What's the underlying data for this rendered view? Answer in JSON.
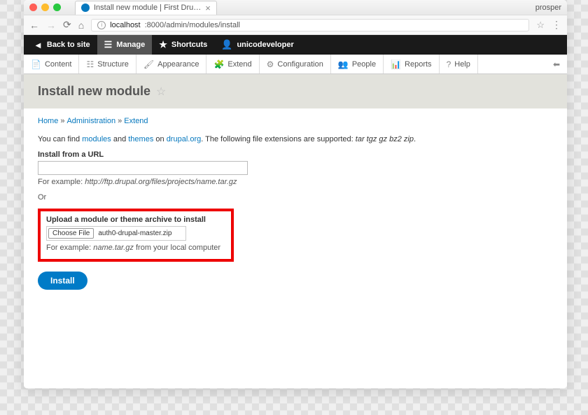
{
  "browser": {
    "tab_title": "Install new module | First Dru…",
    "profile_name": "prosper",
    "url_host": "localhost",
    "url_path": ":8000/admin/modules/install"
  },
  "blackbar": {
    "back": "Back to site",
    "manage": "Manage",
    "shortcuts": "Shortcuts",
    "user": "unicodeveloper"
  },
  "toolbar": {
    "content": "Content",
    "structure": "Structure",
    "appearance": "Appearance",
    "extend": "Extend",
    "configuration": "Configuration",
    "people": "People",
    "reports": "Reports",
    "help": "Help"
  },
  "page": {
    "title": "Install new module",
    "breadcrumb": {
      "home": "Home",
      "admin": "Administration",
      "extend": "Extend"
    },
    "intro1": "You can find ",
    "link_modules": "modules",
    "intro2": " and ",
    "link_themes": "themes",
    "intro3": " on ",
    "link_drupal": "drupal.org",
    "intro4": ". The following file extensions are supported: ",
    "extensions": "tar tgz gz bz2 zip",
    "intro5": ".",
    "url_label": "Install from a URL",
    "url_hint_prefix": "For example: ",
    "url_hint": "http://ftp.drupal.org/files/projects/name.tar.gz",
    "or": "Or",
    "upload_label": "Upload a module or theme archive to install",
    "choose_file": "Choose File",
    "filename": "auth0-drupal-master.zip",
    "upload_hint_prefix": "For example: ",
    "upload_hint_file": "name.tar.gz",
    "upload_hint_suffix": " from your local computer",
    "install_btn": "Install"
  }
}
